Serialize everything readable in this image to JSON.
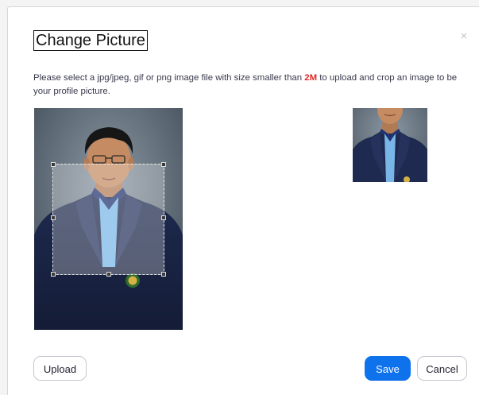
{
  "dialog": {
    "title": "Change Picture",
    "close_icon": "close-icon",
    "description_prefix": "Please select a jpg/jpeg, gif or png image file with size smaller than ",
    "description_highlight": "2M",
    "description_suffix": " to upload and crop an image to be your profile picture.",
    "highlight_color": "#e02828"
  },
  "buttons": {
    "upload_label": "Upload",
    "save_label": "Save",
    "cancel_label": "Cancel",
    "save_color": "#0e72ed"
  }
}
